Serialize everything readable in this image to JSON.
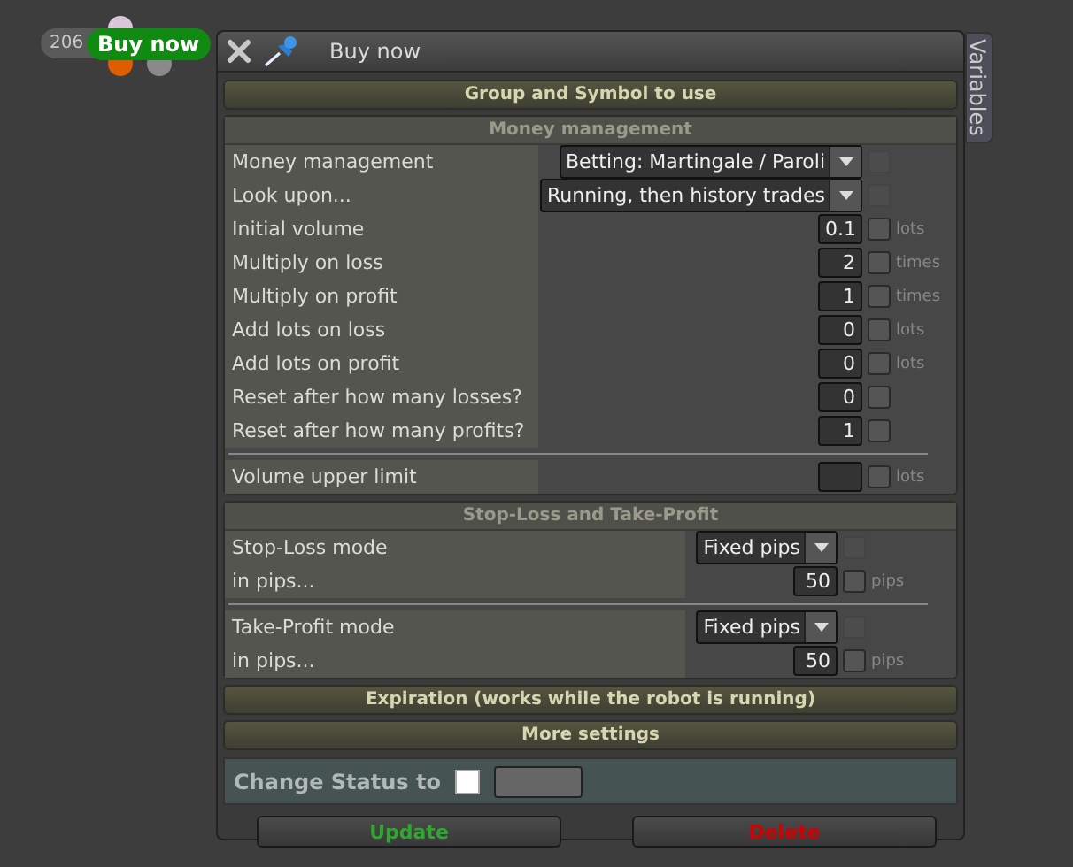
{
  "marker": {
    "count": "206",
    "label": "Buy now"
  },
  "window": {
    "title": "Buy now",
    "side_tab": "Variables"
  },
  "sections": [
    {
      "kind": "header",
      "title": "Group and Symbol to use",
      "expanded": false
    },
    {
      "kind": "panel",
      "title": "Money management",
      "expanded": true,
      "rows": [
        {
          "kind": "select",
          "label": "Money management",
          "value": "Betting: Martingale / Paroli",
          "checked": false
        },
        {
          "kind": "select",
          "label": "Look upon...",
          "value": "Running, then history trades",
          "checked": false
        },
        {
          "kind": "number",
          "label": "Initial volume",
          "value": "0.1",
          "checked": false,
          "unit": "lots"
        },
        {
          "kind": "number",
          "label": "Multiply on loss",
          "value": "2",
          "checked": false,
          "unit": "times"
        },
        {
          "kind": "number",
          "label": "Multiply on profit",
          "value": "1",
          "checked": false,
          "unit": "times"
        },
        {
          "kind": "number",
          "label": "Add lots on loss",
          "value": "0",
          "checked": false,
          "unit": "lots"
        },
        {
          "kind": "number",
          "label": "Add lots on profit",
          "value": "0",
          "checked": false,
          "unit": "lots"
        },
        {
          "kind": "number",
          "label": "Reset after how many losses?",
          "value": "0",
          "checked": false
        },
        {
          "kind": "number",
          "label": "Reset after how many profits?",
          "value": "1",
          "checked": false
        },
        {
          "kind": "divider"
        },
        {
          "kind": "number",
          "label": "Volume upper limit",
          "checked": false,
          "unit": "lots"
        }
      ]
    },
    {
      "kind": "panel",
      "title": "Stop-Loss and Take-Profit",
      "expanded": true,
      "rows": [
        {
          "kind": "select",
          "label": "Stop-Loss mode",
          "value": "Fixed pips",
          "checked": false
        },
        {
          "kind": "number",
          "label": "in pips...",
          "value": "50",
          "checked": false,
          "unit": "pips"
        },
        {
          "kind": "divider"
        },
        {
          "kind": "select",
          "label": "Take-Profit mode",
          "value": "Fixed pips",
          "checked": false
        },
        {
          "kind": "number",
          "label": "in pips...",
          "value": "50",
          "checked": false,
          "unit": "pips"
        }
      ]
    },
    {
      "kind": "header",
      "title": "Expiration (works while the robot is running)",
      "expanded": false
    },
    {
      "kind": "header",
      "title": "More settings",
      "expanded": false
    }
  ],
  "status": {
    "label": "Change Status to",
    "checked": false
  },
  "buttons": [
    {
      "label": "Update",
      "color": "#2ea82e"
    },
    {
      "label": "Delete",
      "color": "#d40000"
    }
  ]
}
